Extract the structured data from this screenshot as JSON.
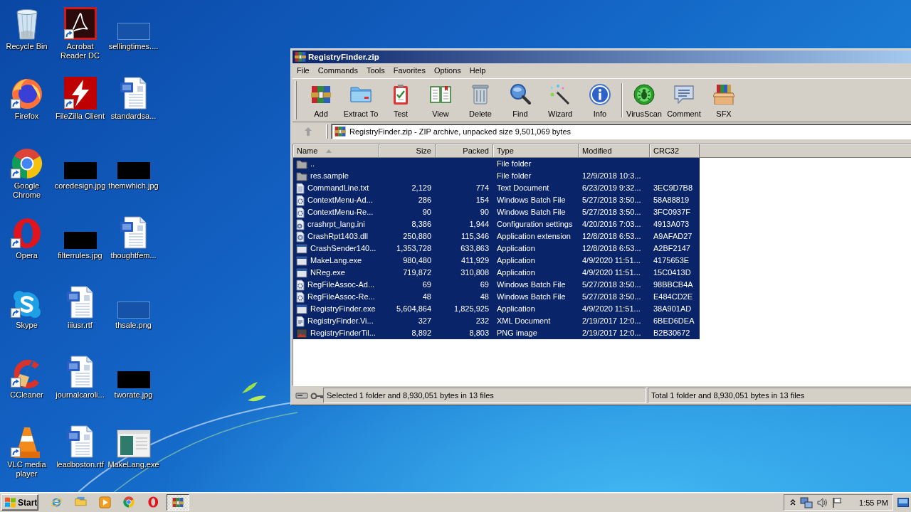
{
  "desktop_icons": [
    {
      "label": "Recycle Bin",
      "kind": "recycle-bin",
      "shortcut": false
    },
    {
      "label": "Firefox",
      "kind": "firefox",
      "shortcut": true
    },
    {
      "label": "Google Chrome",
      "kind": "chrome",
      "shortcut": true
    },
    {
      "label": "Opera",
      "kind": "opera",
      "shortcut": true
    },
    {
      "label": "Skype",
      "kind": "skype",
      "shortcut": true
    },
    {
      "label": "CCleaner",
      "kind": "ccleaner",
      "shortcut": true
    },
    {
      "label": "VLC media player",
      "kind": "vlc",
      "shortcut": true
    },
    {
      "label": "Acrobat Reader DC",
      "kind": "acrobat",
      "shortcut": true
    },
    {
      "label": "FileZilla Client",
      "kind": "filezilla",
      "shortcut": true
    },
    {
      "label": "coredesign.jpg",
      "kind": "image-dark",
      "shortcut": false
    },
    {
      "label": "filterrules.jpg",
      "kind": "image-dark",
      "shortcut": false
    },
    {
      "label": "iiiusr.rtf",
      "kind": "document",
      "shortcut": false
    },
    {
      "label": "journalcaroli...",
      "kind": "document",
      "shortcut": false
    },
    {
      "label": "leadboston.rtf",
      "kind": "document",
      "shortcut": false
    },
    {
      "label": "sellingtimes....",
      "kind": "image-faint",
      "shortcut": false
    },
    {
      "label": "standardsa...",
      "kind": "document",
      "shortcut": false
    },
    {
      "label": "themwhich.jpg",
      "kind": "image-dark",
      "shortcut": false
    },
    {
      "label": "thoughtfem...",
      "kind": "document",
      "shortcut": false
    },
    {
      "label": "thsale.png",
      "kind": "image-faint",
      "shortcut": false
    },
    {
      "label": "tworate.jpg",
      "kind": "image-dark",
      "shortcut": false
    },
    {
      "label": "MakeLang.exe",
      "kind": "program",
      "shortcut": false
    }
  ],
  "window": {
    "title": "RegistryFinder.zip"
  },
  "menu": [
    "File",
    "Commands",
    "Tools",
    "Favorites",
    "Options",
    "Help"
  ],
  "toolbar": {
    "groups": [
      [
        {
          "label": "Add",
          "kind": "add"
        },
        {
          "label": "Extract To",
          "kind": "extract"
        },
        {
          "label": "Test",
          "kind": "test"
        },
        {
          "label": "View",
          "kind": "view"
        },
        {
          "label": "Delete",
          "kind": "delete"
        },
        {
          "label": "Find",
          "kind": "find"
        },
        {
          "label": "Wizard",
          "kind": "wizard"
        },
        {
          "label": "Info",
          "kind": "info"
        }
      ],
      [
        {
          "label": "VirusScan",
          "kind": "virusscan"
        },
        {
          "label": "Comment",
          "kind": "comment"
        },
        {
          "label": "SFX",
          "kind": "sfx"
        }
      ]
    ]
  },
  "address": {
    "up_button": {
      "disabled": true
    },
    "path": "RegistryFinder.zip - ZIP archive, unpacked size 9,501,069 bytes"
  },
  "file_list": {
    "columns": [
      {
        "label": "Name",
        "sorted": true
      },
      {
        "label": "Size",
        "sorted": false
      },
      {
        "label": "Packed",
        "sorted": false
      },
      {
        "label": "Type",
        "sorted": false
      },
      {
        "label": "Modified",
        "sorted": false
      },
      {
        "label": "CRC32",
        "sorted": false
      }
    ],
    "rows": [
      {
        "kind": "folder",
        "name": "..",
        "type": "File folder",
        "selected": true
      },
      {
        "kind": "folder",
        "name": "res.sample",
        "type": "File folder",
        "modified": "12/9/2018 10:3...",
        "selected": true
      },
      {
        "kind": "text",
        "name": "CommandLine.txt",
        "size": "2,129",
        "packed": "774",
        "type": "Text Document",
        "modified": "6/23/2019 9:32...",
        "crc32": "3EC9D7B8",
        "selected": true
      },
      {
        "kind": "batch",
        "name": "ContextMenu-Ad...",
        "size": "286",
        "packed": "154",
        "type": "Windows Batch File",
        "modified": "5/27/2018 3:50...",
        "crc32": "58A88819",
        "selected": true
      },
      {
        "kind": "batch",
        "name": "ContextMenu-Re...",
        "size": "90",
        "packed": "90",
        "type": "Windows Batch File",
        "modified": "5/27/2018 3:50...",
        "crc32": "3FC0937F",
        "selected": true
      },
      {
        "kind": "settings",
        "name": "crashrpt_lang.ini",
        "size": "8,386",
        "packed": "1,944",
        "type": "Configuration settings",
        "modified": "4/20/2016 7:03...",
        "crc32": "4913A073",
        "selected": true
      },
      {
        "kind": "library",
        "name": "CrashRpt1403.dll",
        "size": "250,880",
        "packed": "115,346",
        "type": "Application extension",
        "modified": "12/8/2018 6:53...",
        "crc32": "A9AFAD27",
        "selected": true
      },
      {
        "kind": "program",
        "name": "CrashSender140...",
        "size": "1,353,728",
        "packed": "633,863",
        "type": "Application",
        "modified": "12/8/2018 6:53...",
        "crc32": "A2BF2147",
        "selected": true
      },
      {
        "kind": "program",
        "name": "MakeLang.exe",
        "size": "980,480",
        "packed": "411,929",
        "type": "Application",
        "modified": "4/9/2020 11:51...",
        "crc32": "4175653E",
        "selected": true
      },
      {
        "kind": "program",
        "name": "NReg.exe",
        "size": "719,872",
        "packed": "310,808",
        "type": "Application",
        "modified": "4/9/2020 11:51...",
        "crc32": "15C0413D",
        "selected": true
      },
      {
        "kind": "batch",
        "name": "RegFileAssoc-Ad...",
        "size": "69",
        "packed": "69",
        "type": "Windows Batch File",
        "modified": "5/27/2018 3:50...",
        "crc32": "98BBCB4A",
        "selected": true
      },
      {
        "kind": "batch",
        "name": "RegFileAssoc-Re...",
        "size": "48",
        "packed": "48",
        "type": "Windows Batch File",
        "modified": "5/27/2018 3:50...",
        "crc32": "E484CD2E",
        "selected": true
      },
      {
        "kind": "program",
        "name": "RegistryFinder.exe",
        "size": "5,604,864",
        "packed": "1,825,925",
        "type": "Application",
        "modified": "4/9/2020 11:51...",
        "crc32": "38A901AD",
        "selected": true
      },
      {
        "kind": "xml",
        "name": "RegistryFinder.Vi...",
        "size": "327",
        "packed": "232",
        "type": "XML Document",
        "modified": "2/19/2017 12:0...",
        "crc32": "6BED6DEA",
        "selected": true
      },
      {
        "kind": "image",
        "name": "RegistryFinderTil...",
        "size": "8,892",
        "packed": "8,803",
        "type": "PNG image",
        "modified": "2/19/2017 12:0...",
        "crc32": "B2B30672",
        "selected": true
      }
    ]
  },
  "status_bar": {
    "selection": "Selected 1 folder and 8,930,051 bytes in 13 files",
    "total": "Total 1 folder and 8,930,051 bytes in 13 files"
  },
  "taskbar": {
    "start_label": "Start",
    "quick_launch": [
      {
        "kind": "ie"
      },
      {
        "kind": "explorer"
      },
      {
        "kind": "media-player"
      },
      {
        "kind": "chrome"
      },
      {
        "kind": "opera"
      }
    ],
    "tasks": [
      {
        "kind": "winrar",
        "selected": true
      }
    ],
    "clock": "1:55 PM"
  }
}
